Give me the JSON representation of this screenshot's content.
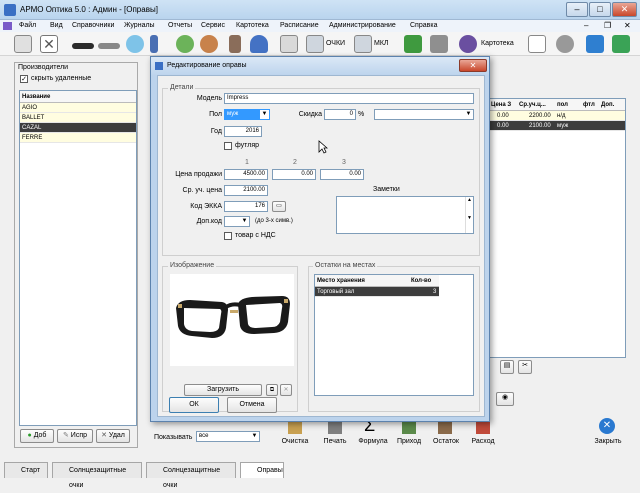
{
  "window": {
    "title": "АРМО Оптика 5.0 : Админ - [Оправы]"
  },
  "menu": [
    "Файл",
    "Вид",
    "Справочники",
    "Журналы",
    "Отчеты",
    "Сервис",
    "Картотека",
    "Расписание",
    "Администрирование",
    "Справка"
  ],
  "toolbar": {
    "ochki": "ОЧКИ",
    "mkl": "МКЛ",
    "kartoteka": "Картотека"
  },
  "left_panel": {
    "title": "Производители",
    "hide_deleted": "скрыть удаленные",
    "list_header": "Название",
    "items": [
      "AGIO",
      "BALLET",
      "CAZAL",
      "FERRE"
    ],
    "selected_index": 2,
    "btn_add": "Доб",
    "btn_edit": "Испр",
    "btn_delete": "Удал"
  },
  "right_grid": {
    "headers": [
      "Цена З",
      "Ср.уч.ц...",
      "пол",
      "фтл",
      "Доп."
    ],
    "rows": [
      [
        "0.00",
        "2200.00",
        "н/д",
        "",
        ""
      ],
      [
        "0.00",
        "2100.00",
        "муж",
        "",
        ""
      ]
    ]
  },
  "dialog": {
    "title": "Редактирование оправы",
    "details_label": "Детали",
    "model_label": "Модель",
    "model_value": "Impress",
    "gender_label": "Пол",
    "gender_value": "муж",
    "discount_label": "Скидка",
    "discount_value": "0",
    "percent": "%",
    "year_label": "Год",
    "year_value": "2016",
    "case_label": "футляр",
    "col1": "1",
    "col2": "2",
    "col3": "3",
    "price_label": "Цена продажи",
    "price1": "4500.00",
    "price2": "0.00",
    "price3": "0.00",
    "avg_label": "Ср. уч. цена",
    "avg_value": "2100.00",
    "ekka_label": "Код ЭККА",
    "ekka_value": "176",
    "addcode_label": "Доп.код",
    "addcode_hint": "(до 3-х симв.)",
    "vat_label": "товар с НДС",
    "notes_label": "Заметки",
    "image_label": "Изображение",
    "load_button": "Загрузить",
    "stock_label": "Остатки на местах",
    "stock_headers": [
      "Место хранения",
      "Кол-во"
    ],
    "stock_rows": [
      [
        "Торговый зал",
        "3"
      ]
    ],
    "ok": "ОК",
    "cancel": "Отмена"
  },
  "bottom": {
    "show_label": "Показывать",
    "show_value": "все",
    "actions": [
      "Очистка",
      "Печать",
      "Формула",
      "Приход",
      "Остаток",
      "Расход"
    ],
    "close": "Закрыть"
  },
  "tabs": [
    "Старт",
    "Солнцезащитные очки",
    "Солнцезащитные очки",
    "Оправы"
  ],
  "colors": {
    "accent": "#3399ff",
    "selection": "#3d3d3d",
    "highlight": "#fffde0"
  }
}
